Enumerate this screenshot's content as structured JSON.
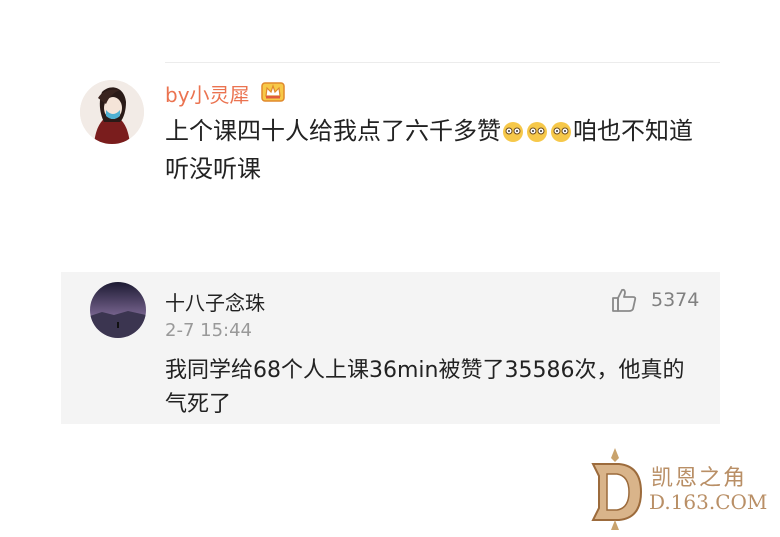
{
  "post": {
    "username": "by小灵犀",
    "content_before": "上个课四十人给我点了六千多赞",
    "emojis": [
      "yellow-face-emoji",
      "yellow-face-emoji",
      "yellow-face-emoji"
    ],
    "content_after": "咱也不知道听没听课"
  },
  "reply": {
    "name": "十八子念珠",
    "time": "2-7 15:44",
    "text": "我同学给68个人上课36min被赞了35586次，他真的气死了",
    "like_count": "5374"
  },
  "watermark": {
    "top": "凯恩之角",
    "bottom": "D.163.COM"
  },
  "colors": {
    "username": "#eb7350",
    "reply_bg": "#f4f4f4"
  }
}
